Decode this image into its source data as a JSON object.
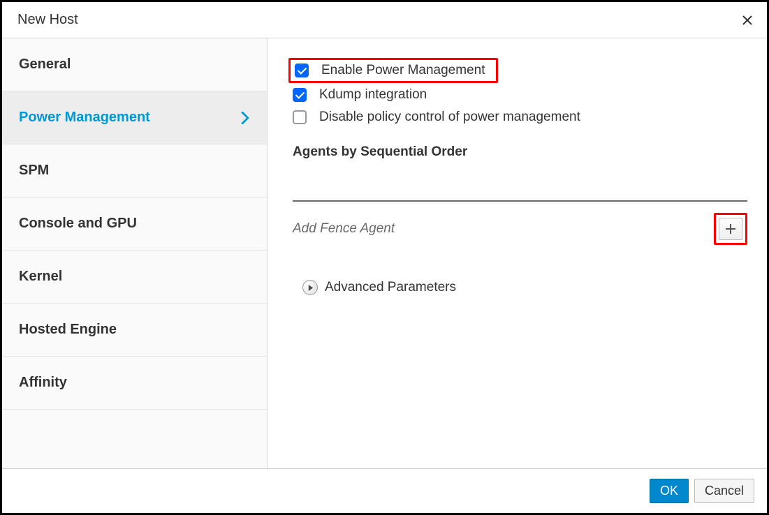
{
  "dialog": {
    "title": "New Host"
  },
  "sidebar": {
    "items": [
      {
        "label": "General",
        "active": false
      },
      {
        "label": "Power Management",
        "active": true
      },
      {
        "label": "SPM",
        "active": false
      },
      {
        "label": "Console and GPU",
        "active": false
      },
      {
        "label": "Kernel",
        "active": false
      },
      {
        "label": "Hosted Engine",
        "active": false
      },
      {
        "label": "Affinity",
        "active": false
      }
    ]
  },
  "pm": {
    "enable_label": "Enable Power Management",
    "enable_checked": true,
    "kdump_label": "Kdump integration",
    "kdump_checked": true,
    "disable_policy_label": "Disable policy control of power management",
    "disable_policy_checked": false,
    "agents_heading": "Agents by Sequential Order",
    "add_fence_label": "Add Fence Agent",
    "advanced_label": "Advanced Parameters"
  },
  "footer": {
    "ok_label": "OK",
    "cancel_label": "Cancel"
  }
}
